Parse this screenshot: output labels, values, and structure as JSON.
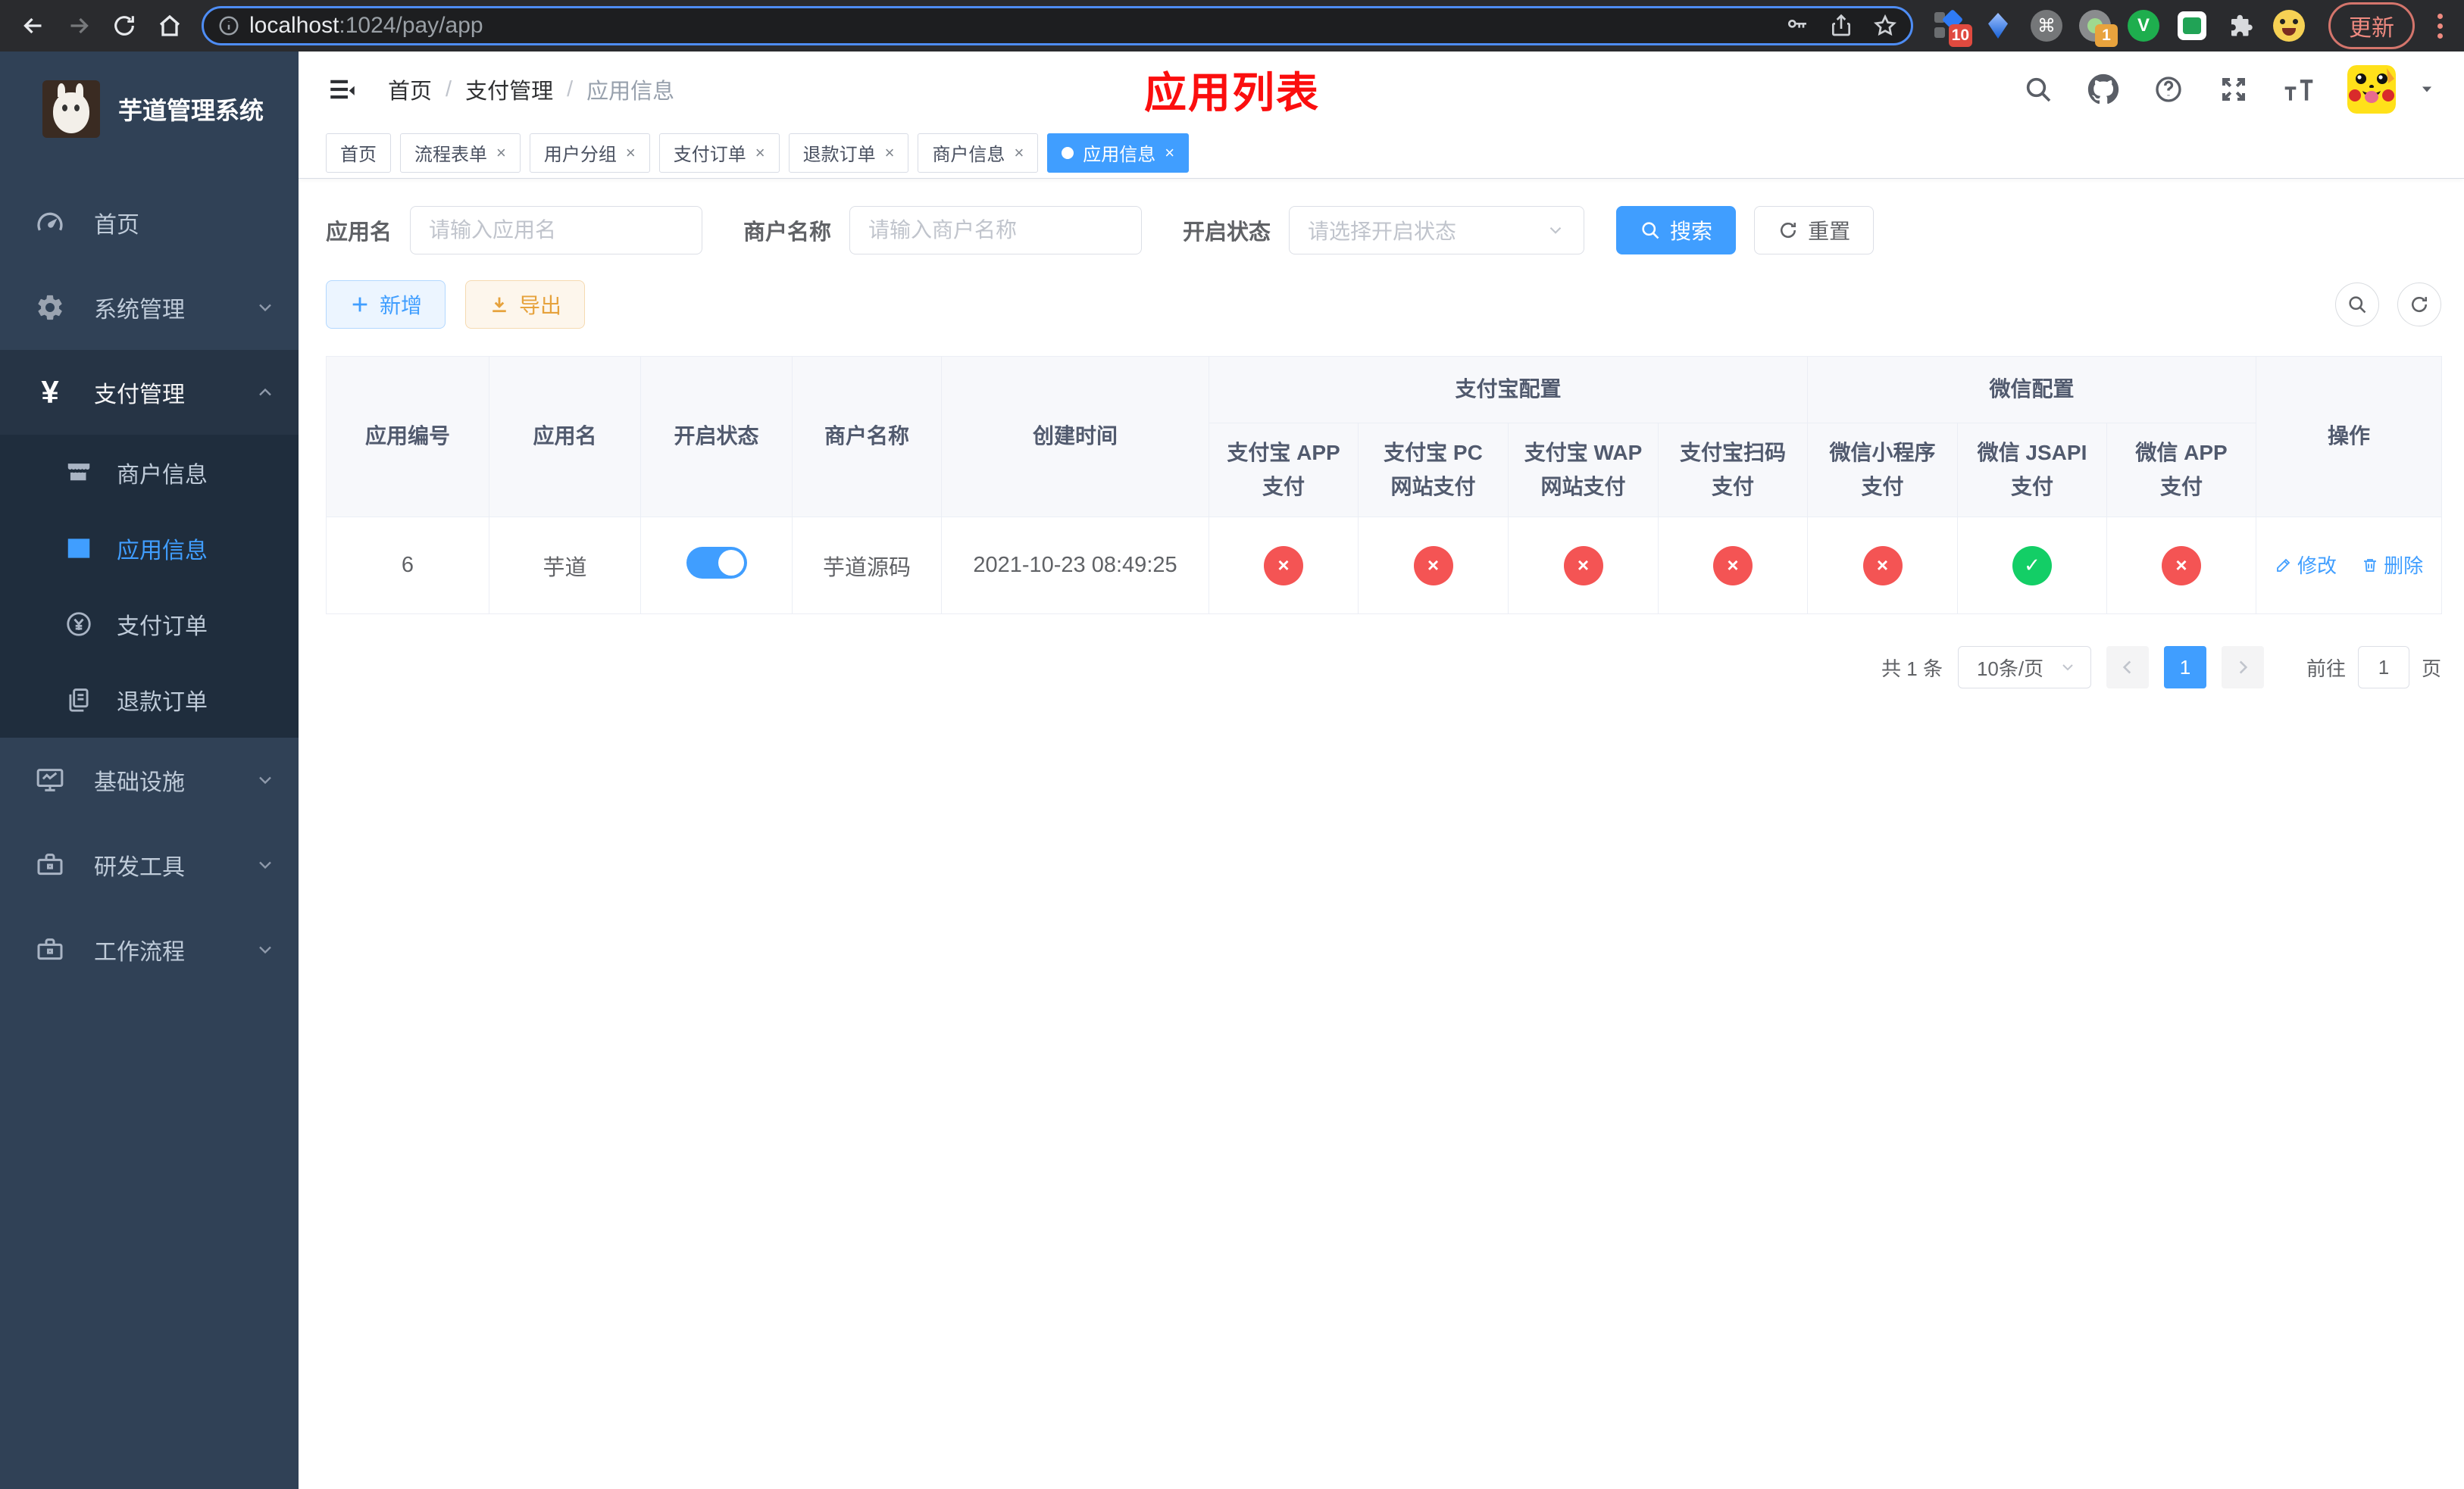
{
  "browser": {
    "url_host": "localhost",
    "url_rest": ":1024/pay/app",
    "update_label": "更新",
    "ext_badge_10": "10",
    "ext_badge_1": "1",
    "ext_cmd_glyph": "⌘",
    "ext_v_glyph": "V"
  },
  "sidebar": {
    "title": "芋道管理系统",
    "items": [
      {
        "label": "首页"
      },
      {
        "label": "系统管理"
      },
      {
        "label": "支付管理"
      },
      {
        "label": "基础设施"
      },
      {
        "label": "研发工具"
      },
      {
        "label": "工作流程"
      }
    ],
    "submenu": [
      {
        "label": "商户信息"
      },
      {
        "label": "应用信息"
      },
      {
        "label": "支付订单"
      },
      {
        "label": "退款订单"
      }
    ],
    "yen_glyph": "¥"
  },
  "navbar": {
    "breadcrumb": [
      "首页",
      "支付管理",
      "应用信息"
    ],
    "overlay_title": "应用列表"
  },
  "tabs": [
    {
      "label": "首页"
    },
    {
      "label": "流程表单"
    },
    {
      "label": "用户分组"
    },
    {
      "label": "支付订单"
    },
    {
      "label": "退款订单"
    },
    {
      "label": "商户信息"
    },
    {
      "label": "应用信息"
    }
  ],
  "filters": {
    "app_name_label": "应用名",
    "app_name_placeholder": "请输入应用名",
    "merchant_label": "商户名称",
    "merchant_placeholder": "请输入商户名称",
    "status_label": "开启状态",
    "status_placeholder": "请选择开启状态",
    "search_label": "搜索",
    "reset_label": "重置"
  },
  "toolbar": {
    "add_label": "新增",
    "export_label": "导出"
  },
  "table": {
    "group_headers": {
      "alipay": "支付宝配置",
      "wechat": "微信配置"
    },
    "columns": [
      "应用编号",
      "应用名",
      "开启状态",
      "商户名称",
      "创建时间",
      "支付宝 APP 支付",
      "支付宝 PC 网站支付",
      "支付宝 WAP 网站支付",
      "支付宝扫码支付",
      "微信小程序支付",
      "微信 JSAPI 支付",
      "微信 APP 支付",
      "操作"
    ],
    "row": {
      "id": "6",
      "name": "芋道",
      "enabled": true,
      "merchant": "芋道源码",
      "created": "2021-10-23 08:49:25",
      "statuses": [
        false,
        false,
        false,
        false,
        false,
        true,
        false
      ],
      "edit_label": "修改",
      "delete_label": "删除"
    }
  },
  "pagination": {
    "total_text": "共 1 条",
    "page_size": "10条/页",
    "current_page": "1",
    "goto_label": "前往",
    "goto_value": "1",
    "unit_label": "页"
  },
  "colors": {
    "accent_blue": "#409eff",
    "sidebar_bg": "#304156",
    "submenu_bg": "#1f2d3d",
    "status_fail": "#f45454",
    "status_ok": "#13ce66",
    "annotation_red": "#fb0e0e"
  }
}
